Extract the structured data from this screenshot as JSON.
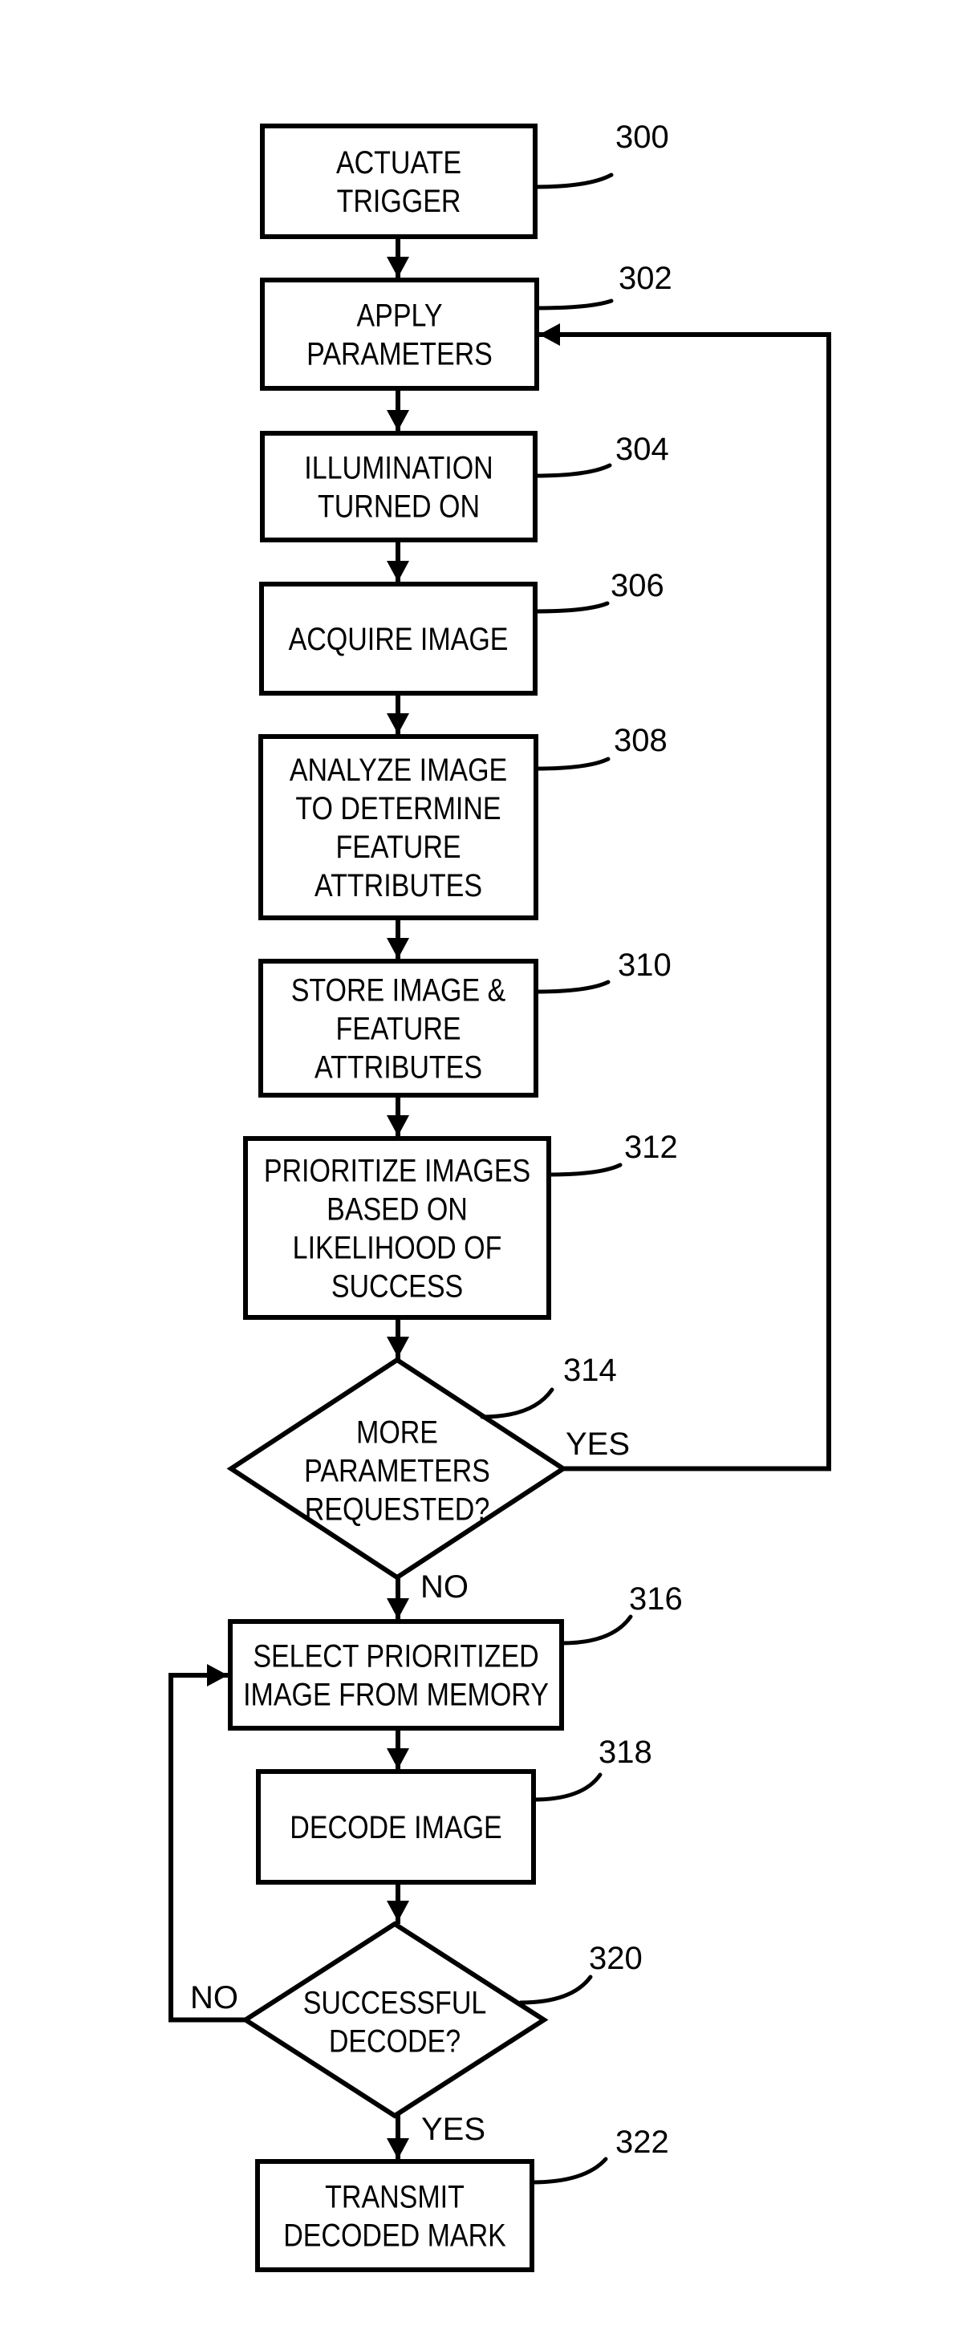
{
  "figure": {
    "nodes": [
      {
        "id": "300",
        "type": "process",
        "lines": [
          "ACTUATE",
          "TRIGGER"
        ]
      },
      {
        "id": "302",
        "type": "process",
        "lines": [
          "APPLY",
          "PARAMETERS"
        ]
      },
      {
        "id": "304",
        "type": "process",
        "lines": [
          "ILLUMINATION",
          "TURNED ON"
        ]
      },
      {
        "id": "306",
        "type": "process",
        "lines": [
          "ACQUIRE  IMAGE"
        ]
      },
      {
        "id": "308",
        "type": "process",
        "lines": [
          "ANALYZE IMAGE",
          "TO DETERMINE",
          "FEATURE",
          "ATTRIBUTES"
        ]
      },
      {
        "id": "310",
        "type": "process",
        "lines": [
          "STORE IMAGE &",
          "FEATURE",
          "ATTRIBUTES"
        ]
      },
      {
        "id": "312",
        "type": "process",
        "lines": [
          "PRIORITIZE IMAGES",
          "BASED ON",
          "LIKELIHOOD OF",
          "SUCCESS"
        ]
      },
      {
        "id": "314",
        "type": "decision",
        "lines": [
          "MORE",
          "PARAMETERS",
          "REQUESTED?"
        ]
      },
      {
        "id": "316",
        "type": "process",
        "lines": [
          "SELECT PRIORITIZED",
          "IMAGE FROM MEMORY"
        ]
      },
      {
        "id": "318",
        "type": "process",
        "lines": [
          "DECODE IMAGE"
        ]
      },
      {
        "id": "320",
        "type": "decision",
        "lines": [
          "SUCCESSFUL",
          "DECODE?"
        ]
      },
      {
        "id": "322",
        "type": "process",
        "lines": [
          "TRANSMIT",
          "DECODED MARK"
        ]
      }
    ],
    "edges": [
      {
        "from": "300",
        "to": "302",
        "label": ""
      },
      {
        "from": "302",
        "to": "304",
        "label": ""
      },
      {
        "from": "304",
        "to": "306",
        "label": ""
      },
      {
        "from": "306",
        "to": "308",
        "label": ""
      },
      {
        "from": "308",
        "to": "310",
        "label": ""
      },
      {
        "from": "310",
        "to": "312",
        "label": ""
      },
      {
        "from": "312",
        "to": "314",
        "label": ""
      },
      {
        "from": "314",
        "to": "302",
        "label": "YES"
      },
      {
        "from": "314",
        "to": "316",
        "label": "NO"
      },
      {
        "from": "316",
        "to": "318",
        "label": ""
      },
      {
        "from": "318",
        "to": "320",
        "label": ""
      },
      {
        "from": "320",
        "to": "316",
        "label": "NO"
      },
      {
        "from": "320",
        "to": "322",
        "label": "YES"
      }
    ]
  }
}
